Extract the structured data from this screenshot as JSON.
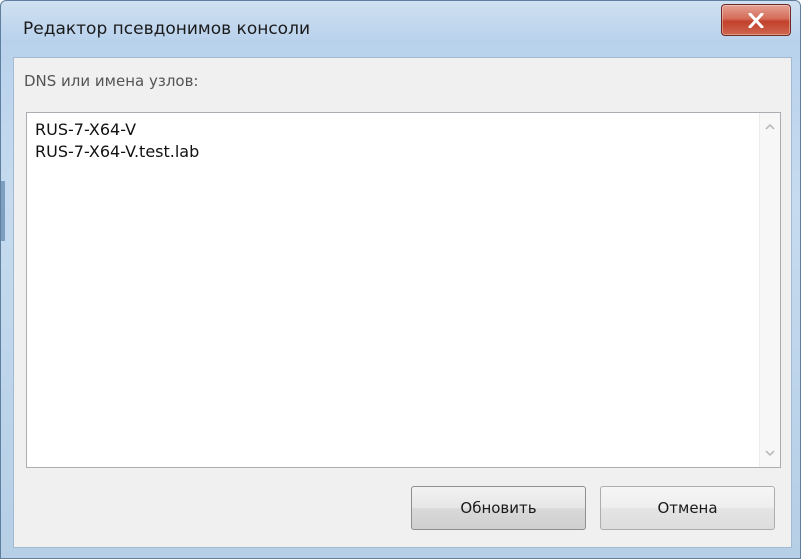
{
  "window": {
    "title": "Редактор псевдонимов консоли"
  },
  "dialog": {
    "field_label": "DNS или имена узлов:",
    "aliases": [
      "RUS-7-X64-V",
      "RUS-7-X64-V.test.lab"
    ],
    "buttons": {
      "update_label": "Обновить",
      "cancel_label": "Отмена"
    }
  },
  "icons": {
    "close": "close-icon",
    "scroll_up": "scroll-up-arrow-icon",
    "scroll_down": "scroll-down-arrow-icon"
  },
  "colors": {
    "title_bar": "#bcd4ea",
    "close_button": "#c2412b",
    "client_background": "#f0f0f0"
  }
}
